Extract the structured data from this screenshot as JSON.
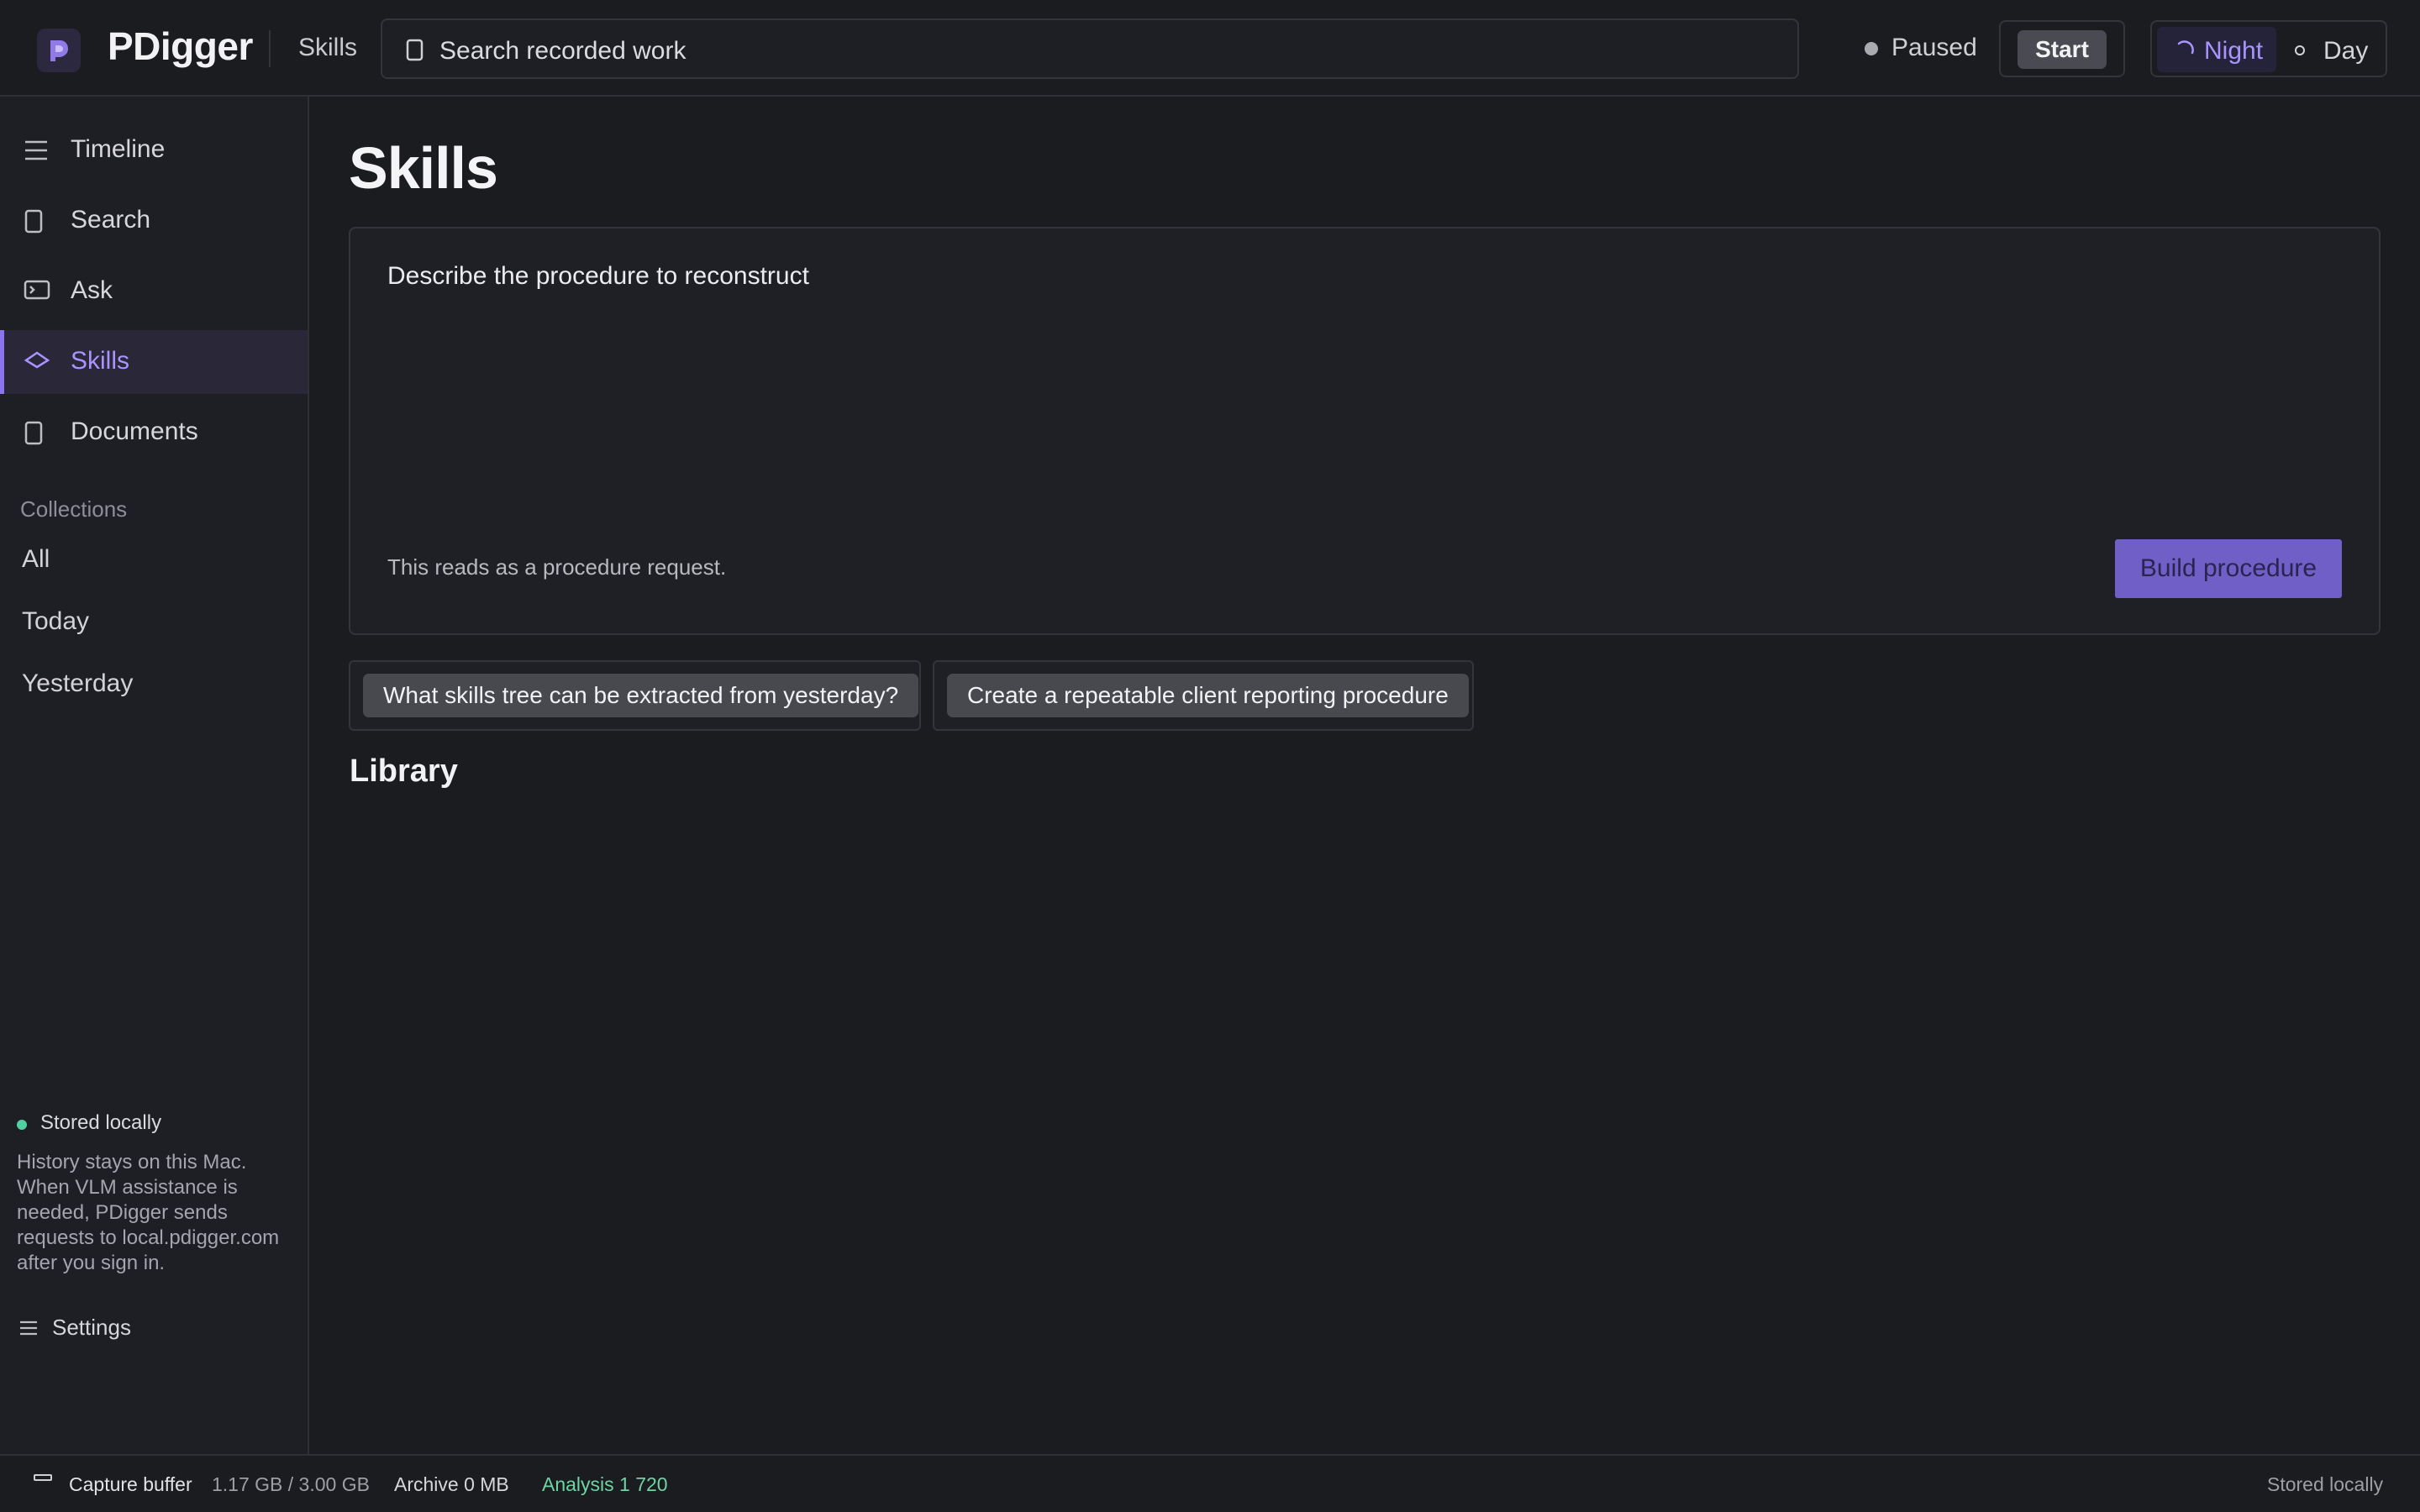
{
  "app": {
    "name": "PDigger",
    "breadcrumb": "Skills"
  },
  "search": {
    "value": "Search recorded work"
  },
  "capture": {
    "status": "Paused",
    "start_label": "Start"
  },
  "theme": {
    "night_label": "Night",
    "day_label": "Day",
    "selected": "Night",
    "accent": "#a994ff"
  },
  "sidebar": {
    "items": [
      {
        "label": "Timeline",
        "icon": "list-icon"
      },
      {
        "label": "Search",
        "icon": "document-icon"
      },
      {
        "label": "Ask",
        "icon": "terminal-icon"
      },
      {
        "label": "Skills",
        "icon": "diamond-icon",
        "active": true
      },
      {
        "label": "Documents",
        "icon": "document-icon"
      }
    ],
    "collections_label": "Collections",
    "collections": [
      "All",
      "Today",
      "Yesterday"
    ],
    "storage": {
      "label": "Stored locally",
      "description": "History stays on this Mac. When VLM assistance is needed, PDigger sends requests to local.pdigger.com after you sign in.",
      "dot_color": "#4fd1a0"
    },
    "settings_label": "Settings"
  },
  "main": {
    "title": "Skills",
    "composer": {
      "value": "Describe the procedure to reconstruct",
      "hint": "This reads as a procedure request.",
      "build_label": "Build procedure"
    },
    "suggestions": [
      "What skills tree can be extracted from yesterday?",
      "Create a repeatable client reporting procedure"
    ],
    "library_title": "Library"
  },
  "footer": {
    "buffer_label": "Capture buffer",
    "buffer_value": "1.17 GB / 3.00 GB",
    "archive": "Archive 0 MB",
    "analysis": "Analysis 1 720",
    "storage": "Stored locally",
    "analysis_color": "#6fd3a3"
  }
}
